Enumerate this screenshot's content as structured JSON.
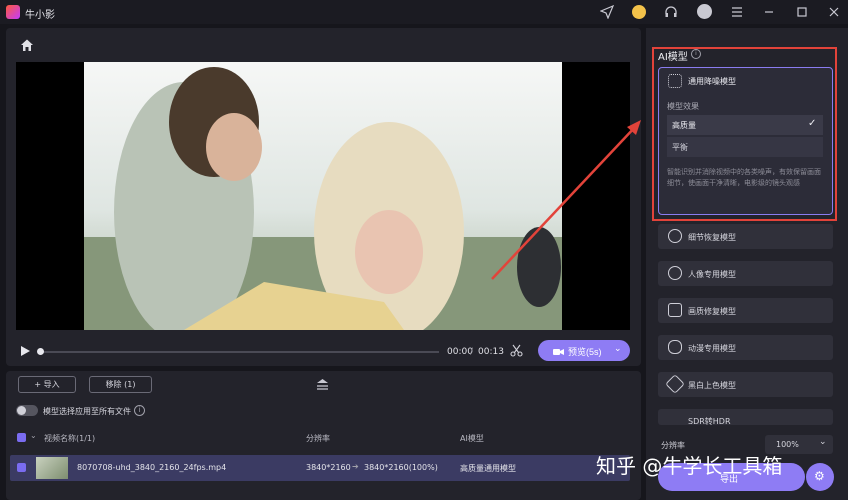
{
  "app": {
    "title": "牛小影"
  },
  "player": {
    "time_current": "00:00",
    "time_sep": "/",
    "time_total": "00:13",
    "preview_label": "预览(5s)",
    "progress": 0
  },
  "file_toolbar": {
    "import_label": "+ 导入",
    "remove_label": "移除 (1)"
  },
  "apply_all": {
    "label": "模型选择应用至所有文件"
  },
  "table": {
    "headers": [
      "视频名称(1/1)",
      "分辨率",
      "AI模型"
    ],
    "rows": [
      {
        "name": "8070708-uhd_3840_2160_24fps.mp4",
        "res_from": "3840*2160",
        "res_to": "3840*2160(100%)",
        "model": "高质量通用模型"
      }
    ]
  },
  "ai_panel": {
    "heading": "AI模型",
    "selected_model": "通用降噪模型",
    "effect_label": "模型效果",
    "options": [
      {
        "label": "高质量",
        "selected": true
      },
      {
        "label": "平衡",
        "selected": false
      }
    ],
    "description": "智能识别并消除视频中的各类噪声，有效保留画面细节，使画面干净清晰，电影级的镜头观感",
    "models": [
      "细节恢复模型",
      "人像专用模型",
      "画质修复模型",
      "动漫专用模型",
      "黑白上色模型"
    ],
    "partial_model": "SDR转HDR"
  },
  "resolution": {
    "label": "分辨率",
    "value": "100%"
  },
  "export": {
    "label": "导出"
  },
  "watermark": {
    "text": "知乎 @牛学长工具箱"
  },
  "colors": {
    "accent": "#8e7cf4",
    "highlight": "#e2433a",
    "panel": "#23232b"
  }
}
